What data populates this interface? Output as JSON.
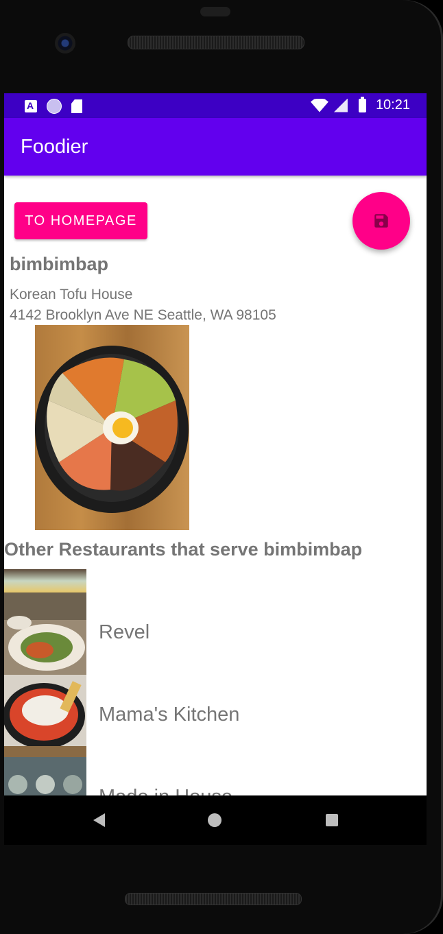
{
  "status_bar": {
    "time": "10:21",
    "left_icons": [
      "a-notification-icon",
      "sync-circle-icon",
      "sd-card-icon"
    ],
    "right_icons": [
      "wifi-icon",
      "cell-signal-icon",
      "battery-icon"
    ]
  },
  "app_bar": {
    "title": "Foodier"
  },
  "actions": {
    "home_button_label": "TO HOMEPAGE",
    "fab_icon": "save-icon"
  },
  "dish": {
    "name": "bimbimbap",
    "restaurant": "Korean Tofu House",
    "address": "4142 Brooklyn Ave NE Seattle, WA 98105",
    "photo_icon": "bibimbap-photo"
  },
  "other_restaurants": {
    "heading": "Other Restaurants that serve bimbimbap",
    "items": [
      {
        "label": "Revel"
      },
      {
        "label": "Mama's Kitchen"
      },
      {
        "label": "Made in House"
      }
    ]
  },
  "nav_bar": {
    "icons": [
      "back-icon",
      "home-icon",
      "recents-icon"
    ]
  },
  "colors": {
    "status_bar": "#3d00c4",
    "app_bar": "#6200ee",
    "accent": "#ff0088",
    "text_secondary": "#757575"
  }
}
